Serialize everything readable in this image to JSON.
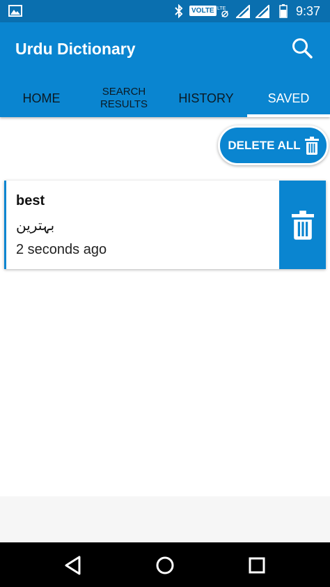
{
  "status_bar": {
    "time": "9:37",
    "volte": "VOLTE",
    "icons": [
      "image-icon",
      "bluetooth-icon",
      "volte-badge",
      "lte-icon",
      "signal-icon",
      "signal-icon",
      "battery-icon"
    ]
  },
  "app_bar": {
    "title": "Urdu Dictionary",
    "search_icon": "search-icon"
  },
  "tabs": [
    {
      "label": "HOME",
      "active": false
    },
    {
      "label": "SEARCH RESULTS",
      "line1": "SEARCH",
      "line2": "RESULTS",
      "active": false
    },
    {
      "label": "HISTORY",
      "active": false
    },
    {
      "label": "SAVED",
      "active": true
    }
  ],
  "actions": {
    "delete_all_label": "DELETE ALL",
    "delete_all_icon": "trash-icon"
  },
  "saved_items": [
    {
      "word": "best",
      "translation": "بہترین",
      "time": "2 seconds ago",
      "delete_icon": "trash-icon"
    }
  ],
  "nav_bar": {
    "buttons": [
      "back-icon",
      "home-icon",
      "recents-icon"
    ]
  },
  "colors": {
    "primary": "#0A85D0",
    "status_bar": "#0A6FAF",
    "tab_text": "#0b1a24",
    "nav_bar": "#000000"
  }
}
